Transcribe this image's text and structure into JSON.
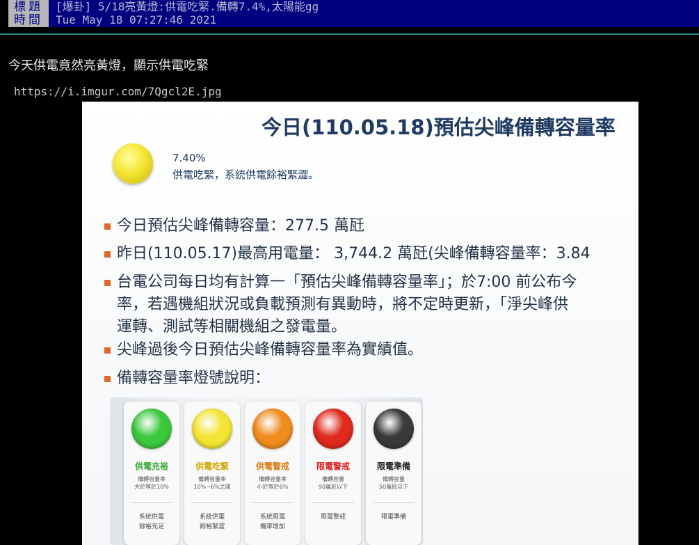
{
  "header": {
    "title_label": "標題",
    "title_value": "[爆卦] 5/18亮黃燈:供電吃緊.備轉7.4%,太陽能gg",
    "time_label": "時間",
    "time_value": "Tue May 18 07:27:46 2021"
  },
  "post": {
    "content_line": "今天供電竟然亮黃燈，顯示供電吃緊",
    "image_url": "https://i.imgur.com/7Qgcl2E.jpg"
  },
  "infographic": {
    "title": "今日(110.05.18)預估尖峰備轉容量率",
    "status_percent": "7.40%",
    "status_desc": "供電吃緊，系統供電餘裕緊澀。",
    "bullets": [
      "今日預估尖峰備轉容量：277.5 萬瓩",
      "昨日(110.05.17)最高用電量： 3,744.2 萬瓩(尖峰備轉容量率：3.84",
      "台電公司每日均有計算一「預估尖峰備轉容量率」；於7:00 前公布今",
      "率，若遇機組狀況或負載預測有異動時，將不定時更新，「淨尖峰供",
      "運轉、測試等相關機組之發電量。",
      "尖峰過後今日預估尖峰備轉容量率為實績值。",
      "備轉容量率燈號說明："
    ],
    "lights": [
      {
        "name": "供電充裕",
        "rule1": "備轉容量率",
        "rule2": "大於等於10%",
        "note1": "系統供電",
        "note2": "餘裕充足",
        "color": "#3cc83c",
        "text_color": "#3aa83a"
      },
      {
        "name": "供電吃緊",
        "rule1": "備轉容量率",
        "rule2": "10%~6%之間",
        "note1": "系統供電",
        "note2": "餘裕緊澀",
        "color": "#f4e534",
        "text_color": "#d1a800"
      },
      {
        "name": "供電警戒",
        "rule1": "備轉容量率",
        "rule2": "小於等於6%",
        "note1": "系統限電",
        "note2": "機率增加",
        "color": "#f08c1e",
        "text_color": "#e07a10"
      },
      {
        "name": "限電警戒",
        "rule1": "備轉容量",
        "rule2": "90萬瓩以下",
        "note1": "限電警戒",
        "note2": "",
        "color": "#e02a1e",
        "text_color": "#d22"
      },
      {
        "name": "限電準備",
        "rule1": "備轉容量",
        "rule2": "50萬瓩以下",
        "note1": "限電準備",
        "note2": "",
        "color": "#3a3a3a",
        "text_color": "#222"
      }
    ]
  }
}
